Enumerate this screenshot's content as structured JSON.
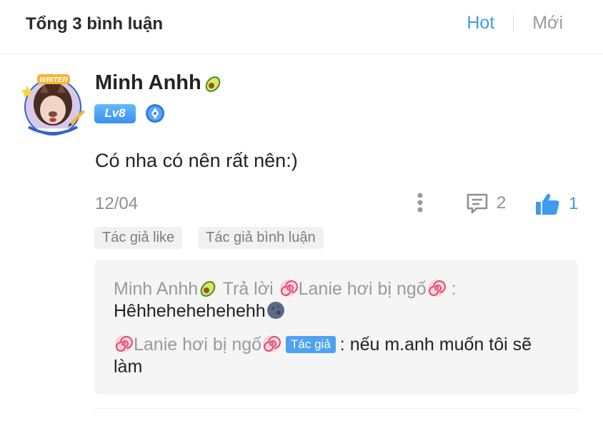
{
  "header": {
    "title": "Tổng 3 bình luận",
    "tabs": [
      {
        "label": "Hot",
        "active": true
      },
      {
        "label": "Mới",
        "active": false
      }
    ]
  },
  "comment": {
    "username": "Minh Anhh",
    "level": "Lv8",
    "text": "Có nha có nên rất nên:)",
    "date": "12/04",
    "reply_count": "2",
    "like_count": "1",
    "tags": [
      "Tác giả like",
      "Tác giả bình luận"
    ]
  },
  "replies": [
    {
      "from": "Minh Anhh",
      "action": "Trả lời",
      "to": "Lanie hơi bị ngố",
      "text": "Hêhhehehehehehh"
    },
    {
      "from": "Lanie hơi bị ngố",
      "badge": "Tác giả",
      "text": "nếu m.anh muốn tôi sẽ làm"
    }
  ],
  "colors": {
    "accent": "#3d9bf0",
    "muted": "#9a9a9a",
    "reply_bg": "#f5f5f5",
    "tag_bg": "#f1f1f1"
  },
  "icons": [
    "avatar",
    "avocado-emoji",
    "writer-pen-icon",
    "more-vertical-icon",
    "comment-icon",
    "thumbs-up-icon",
    "swirl-emoji",
    "moon-emoji"
  ]
}
